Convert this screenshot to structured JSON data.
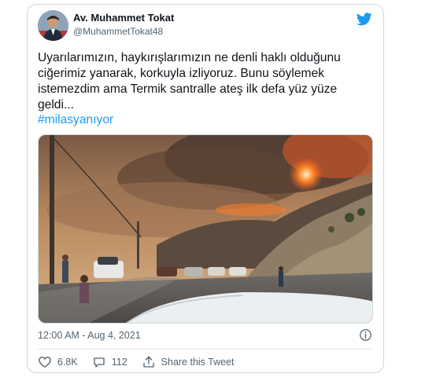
{
  "tweet": {
    "author": {
      "display_name": "Av. Muhammet Tokat",
      "handle": "@MuhammetTokat48"
    },
    "text": "Uyarılarımızın, haykırışlarımızın ne denli haklı olduğunu\nciğerimiz yanarak, korkuyla izliyoruz. Bunu söylemek\nistemezdim ama Termik santralle ateş ilk defa yüz yüze\ngeldi...",
    "hashtag": "#milasyanıyor",
    "timestamp": "12:00 AM - Aug 4, 2021",
    "likes": "6.8K",
    "replies": "112",
    "share_label": "Share this Tweet"
  },
  "icons": {
    "brand": "twitter-bird-icon",
    "info": "info-icon",
    "like": "heart-icon",
    "reply": "reply-icon",
    "share": "share-icon"
  },
  "colors": {
    "brand_blue": "#1d9bf0",
    "text_primary": "#0f1419",
    "text_secondary": "#536471",
    "border": "#cfd9de"
  }
}
